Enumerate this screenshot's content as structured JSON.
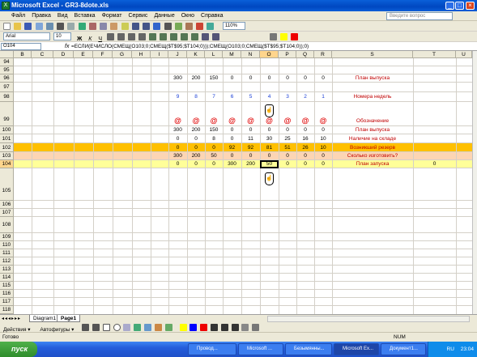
{
  "window": {
    "title": "Microsoft Excel - GR3-8dote.xls",
    "min": "_",
    "max": "□",
    "close": "×"
  },
  "menu": [
    "Файл",
    "Правка",
    "Вид",
    "Вставка",
    "Формат",
    "Сервис",
    "Данные",
    "Окно",
    "Справка"
  ],
  "help_placeholder": "Введите вопрос",
  "font": {
    "name": "Arial",
    "size": "10",
    "zoom": "110%"
  },
  "formula_bar": {
    "cell": "O104",
    "fx": "fx",
    "formula": "=ЕСЛИ(ЕЧИСЛО(СМЕЩ(O103;0;СМЕЩ($T$95;$T104;0)));СМЕЩ(O103;0;СМЕЩ($T$95;$T104;0));0)"
  },
  "columns": [
    "B",
    "C",
    "D",
    "E",
    "F",
    "G",
    "H",
    "I",
    "J",
    "K",
    "L",
    "M",
    "N",
    "O",
    "P",
    "Q",
    "R",
    "S",
    "T",
    "U"
  ],
  "selected_column": "O",
  "rows": [
    "94",
    "95",
    "96",
    "97",
    "98",
    "99",
    "100",
    "101",
    "102",
    "103",
    "104",
    "105",
    "106",
    "107",
    "108",
    "109",
    "110",
    "111",
    "112",
    "113",
    "114",
    "115",
    "116",
    "117",
    "118"
  ],
  "selected_row": "104",
  "sheet": {
    "r96": {
      "values": [
        "300",
        "200",
        "150",
        "0",
        "0",
        "0",
        "0",
        "0",
        "0"
      ],
      "label": "План выпуска"
    },
    "r98": {
      "values": [
        "9",
        "8",
        "7",
        "6",
        "5",
        "4",
        "3",
        "2",
        "1"
      ],
      "label": "Номера недель"
    },
    "r99": {
      "values": [
        "@",
        "@",
        "@",
        "@",
        "@",
        "@",
        "@",
        "@",
        "@"
      ],
      "label": "Обозначение"
    },
    "r100": {
      "values": [
        "300",
        "200",
        "150",
        "0",
        "0",
        "0",
        "0",
        "0",
        "0"
      ],
      "label": "План выпуска"
    },
    "r101": {
      "values": [
        "0",
        "0",
        "8",
        "0",
        "11",
        "30",
        "25",
        "16",
        "10"
      ],
      "label": "Наличие на складе"
    },
    "r102": {
      "values": [
        "0",
        "0",
        "0",
        "92",
        "92",
        "81",
        "51",
        "26",
        "10"
      ],
      "label": "Возникший резерв"
    },
    "r103": {
      "values": [
        "300",
        "200",
        "50",
        "0",
        "0",
        "0",
        "0",
        "0",
        "0"
      ],
      "label": "Сколько изготовить?"
    },
    "r104": {
      "values": [
        "0",
        "0",
        "0",
        "300",
        "200",
        "50",
        "0",
        "0",
        "0"
      ],
      "label": "План запуска",
      "t_value": "0"
    }
  },
  "tabs": [
    "Diagram1",
    "Page1"
  ],
  "active_tab": "Page1",
  "drawing": {
    "actions": "Действия ▾",
    "autoshapes": "Автофигуры ▾"
  },
  "status": {
    "left": "Готово",
    "num": "NUM"
  },
  "taskbar": {
    "start": "пуск",
    "tasks": [
      "Провод...",
      "Microsoft ...",
      "Безымянны...",
      "Microsoft Ex...",
      "Документ1..."
    ],
    "lang": "RU",
    "clock": "23:04"
  },
  "colors": {
    "orange_row": "#ffc000",
    "peach_row": "#fcd5b4",
    "yellow_row": "#ffff99",
    "label_red": "#c00000",
    "blue_numbers": "#1a3fd6"
  }
}
